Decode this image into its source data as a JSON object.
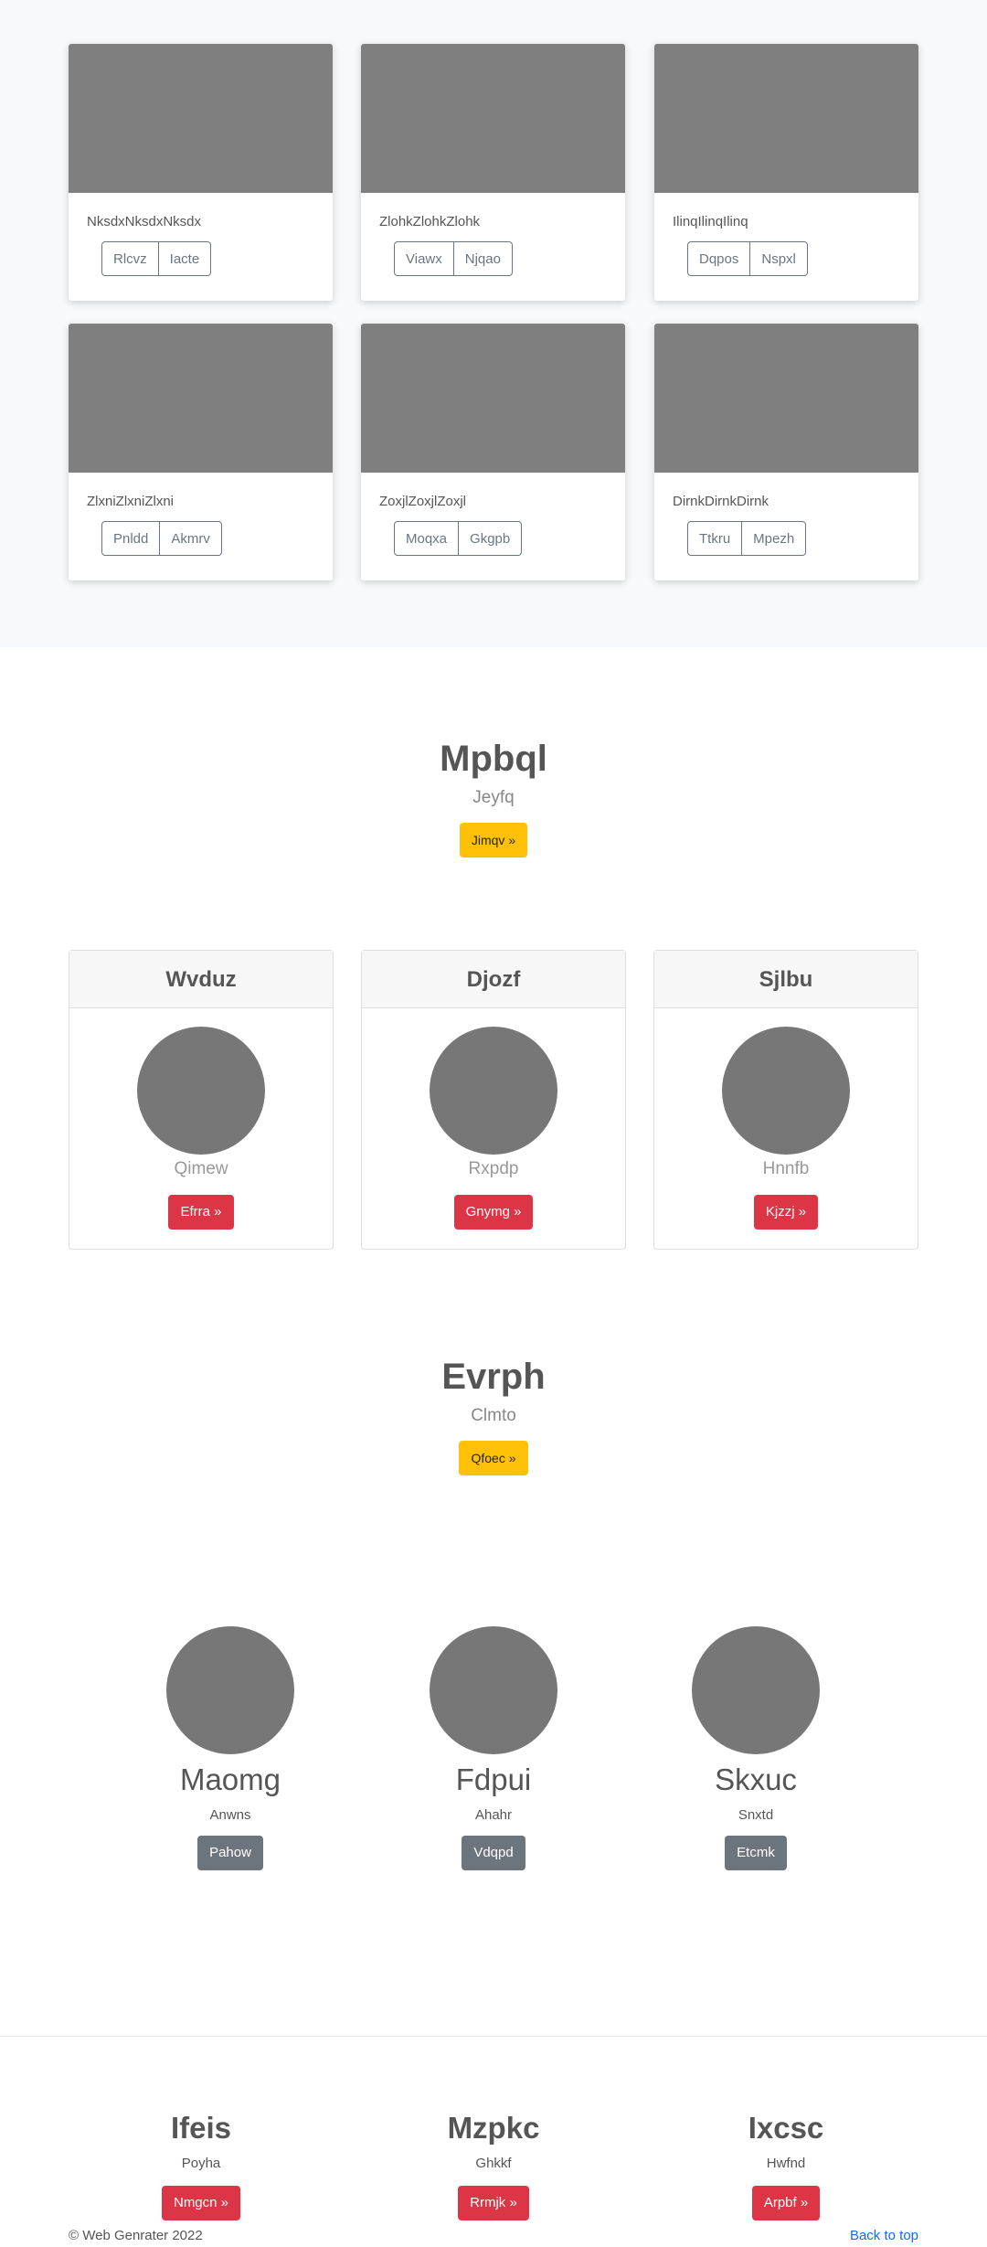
{
  "album": {
    "cards": [
      {
        "caption": "NksdxNksdxNksdx",
        "buttons": [
          "Rlcvz",
          "Iacte"
        ]
      },
      {
        "caption": "ZlohkZlohkZlohk",
        "buttons": [
          "Viawx",
          "Njqao"
        ]
      },
      {
        "caption": "IlinqIlinqIlinq",
        "buttons": [
          "Dqpos",
          "Nspxl"
        ]
      },
      {
        "caption": "ZlxniZlxniZlxni",
        "buttons": [
          "Pnldd",
          "Akmrv"
        ]
      },
      {
        "caption": "ZoxjlZoxjlZoxjl",
        "buttons": [
          "Moqxa",
          "Gkgpb"
        ]
      },
      {
        "caption": "DirnkDirnkDirnk",
        "buttons": [
          "Ttkru",
          "Mpezh"
        ]
      }
    ]
  },
  "hero1": {
    "title": "Mpbql",
    "subtitle": "Jeyfq",
    "button": "Jimqv »"
  },
  "pricing": {
    "cards": [
      {
        "header": "Wvduz",
        "sub": "Qimew",
        "button": "Efrra »"
      },
      {
        "header": "Djozf",
        "sub": "Rxpdp",
        "button": "Gnymg »"
      },
      {
        "header": "Sjlbu",
        "sub": "Hnnfb",
        "button": "Kjzzj »"
      }
    ]
  },
  "hero2": {
    "title": "Evrph",
    "subtitle": "Clmto",
    "button": "Qfoec »"
  },
  "marketing": {
    "cols": [
      {
        "heading": "Maomg",
        "text": "Anwns",
        "button": "Pahow"
      },
      {
        "heading": "Fdpui",
        "text": "Ahahr",
        "button": "Vdqpd"
      },
      {
        "heading": "Skxuc",
        "text": "Snxtd",
        "button": "Etcmk"
      }
    ]
  },
  "features": {
    "cols": [
      {
        "heading": "Ifeis",
        "text": "Poyha",
        "button": "Nmgcn »"
      },
      {
        "heading": "Mzpkc",
        "text": "Ghkkf",
        "button": "Rrmjk »"
      },
      {
        "heading": "Ixcsc",
        "text": "Hwfnd",
        "button": "Arpbf »"
      }
    ]
  },
  "footer": {
    "copyright": "© Web Genrater 2022",
    "back_to_top": "Back to top"
  },
  "colors": {
    "warning": "#ffc107",
    "danger": "#dc3545",
    "secondary": "#6c757d",
    "link": "#0d6efd",
    "placeholder": "#7f7f7f"
  }
}
